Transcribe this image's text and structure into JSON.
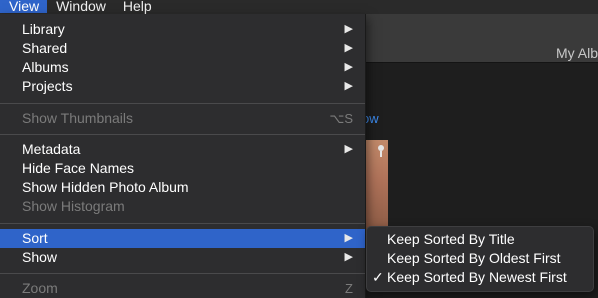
{
  "menubar": {
    "items": [
      {
        "label": "View",
        "active": true
      },
      {
        "label": "Window",
        "active": false
      },
      {
        "label": "Help",
        "active": false
      }
    ]
  },
  "window": {
    "album_title": "My Alb",
    "slideshow_link": "ow"
  },
  "view_menu": {
    "items": [
      {
        "label": "Library",
        "submenu": true
      },
      {
        "label": "Shared",
        "submenu": true
      },
      {
        "label": "Albums",
        "submenu": true
      },
      {
        "label": "Projects",
        "submenu": true
      },
      {
        "label": "Show Thumbnails",
        "shortcut": "⌥S",
        "enabled": false
      },
      {
        "label": "Metadata",
        "submenu": true
      },
      {
        "label": "Hide Face Names"
      },
      {
        "label": "Show Hidden Photo Album"
      },
      {
        "label": "Show Histogram",
        "enabled": false
      },
      {
        "label": "Sort",
        "submenu": true,
        "highlighted": true
      },
      {
        "label": "Show",
        "submenu": true
      },
      {
        "label": "Zoom",
        "shortcut": "Z",
        "enabled": false
      }
    ],
    "arrow_glyph": "▶"
  },
  "sort_submenu": {
    "check_glyph": "✓",
    "items": [
      {
        "label": "Keep Sorted By Title",
        "checked": false
      },
      {
        "label": "Keep Sorted By Oldest First",
        "checked": false
      },
      {
        "label": "Keep Sorted By Newest First",
        "checked": true
      }
    ]
  },
  "colors": {
    "highlight": "#2f64c9",
    "menu_bg": "#2d2d2f",
    "disabled_text": "#7b7b7b"
  }
}
